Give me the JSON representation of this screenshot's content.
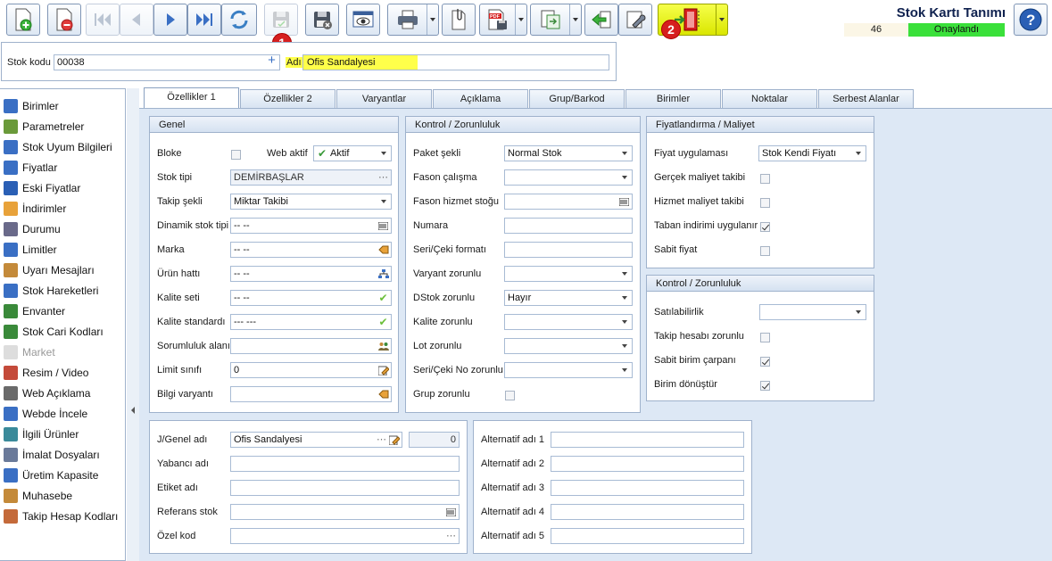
{
  "app": {
    "title": "Stok Kartı Tanımı",
    "status_code": "46",
    "status_label": "Onaylandı"
  },
  "colors": {
    "accent": "#10224f",
    "status": "#3ae03a",
    "highlight": "#ffff4a",
    "badge": "#d61f1f"
  },
  "toolbar": {
    "items": [
      "new-icon",
      "delete-icon",
      "first-icon",
      "prev-icon",
      "next-icon",
      "last-icon",
      "refresh-icon",
      "save-disabled-icon",
      "save-close-icon",
      "preview-icon",
      "print-icon",
      "attach-icon",
      "pdf-icon",
      "export-icon",
      "back-icon",
      "settings-icon",
      "workflow-icon"
    ],
    "badges": [
      "1",
      "2"
    ]
  },
  "header": {
    "stock_code_label": "Stok kodu",
    "stock_code_value": "00038",
    "name_label": "Adı",
    "name_value": "Ofis Sandalyesi"
  },
  "sidebar": {
    "items": [
      {
        "label": "Birimler",
        "icon": "units-icon"
      },
      {
        "label": "Parametreler",
        "icon": "parameters-icon"
      },
      {
        "label": "Stok Uyum Bilgileri",
        "icon": "compliance-icon"
      },
      {
        "label": "Fiyatlar",
        "icon": "price-tag-icon"
      },
      {
        "label": "Eski Fiyatlar",
        "icon": "old-price-icon"
      },
      {
        "label": "İndirimler",
        "icon": "discount-icon"
      },
      {
        "label": "Durumu",
        "icon": "status-icon"
      },
      {
        "label": "Limitler",
        "icon": "limits-icon"
      },
      {
        "label": "Uyarı Mesajları",
        "icon": "warning-icon"
      },
      {
        "label": "Stok Hareketleri",
        "icon": "movements-icon"
      },
      {
        "label": "Envanter",
        "icon": "inventory-icon"
      },
      {
        "label": "Stok Cari Kodları",
        "icon": "account-codes-icon"
      },
      {
        "label": "Market",
        "icon": "market-icon"
      },
      {
        "label": "Resim / Video",
        "icon": "media-icon"
      },
      {
        "label": "Web Açıklama",
        "icon": "web-desc-icon"
      },
      {
        "label": "Webde İncele",
        "icon": "web-view-icon"
      },
      {
        "label": "İlgili Ürünler",
        "icon": "related-icon"
      },
      {
        "label": "İmalat Dosyaları",
        "icon": "manufacturing-icon"
      },
      {
        "label": "Üretim Kapasite",
        "icon": "capacity-icon"
      },
      {
        "label": "Muhasebe",
        "icon": "accounting-icon"
      },
      {
        "label": "Takip Hesap Kodları",
        "icon": "tracking-icon"
      }
    ]
  },
  "tabs": [
    "Özellikler 1",
    "Özellikler 2",
    "Varyantlar",
    "Açıklama",
    "Grup/Barkod",
    "Birimler",
    "Noktalar",
    "Serbest Alanlar"
  ],
  "genel": {
    "title": "Genel",
    "bloke": "Bloke",
    "web_aktif": "Web aktif",
    "web_aktif_value": "Aktif",
    "stok_tipi": "Stok tipi",
    "stok_tipi_value": "DEMİRBAŞLAR",
    "takip_sekli": "Takip şekli",
    "takip_sekli_value": "Miktar Takibi",
    "dinamik_stok_tipi": "Dinamik stok tipi",
    "dinamik_stok_tipi_value": "-- --",
    "marka": "Marka",
    "marka_value": "-- --",
    "urun_hatti": "Ürün hattı",
    "urun_hatti_value": "-- --",
    "kalite_seti": "Kalite seti",
    "kalite_seti_value": "-- --",
    "kalite_standardi": "Kalite standardı",
    "kalite_standardi_value": "--- ---",
    "sorumluluk_alani": "Sorumluluk alanı",
    "sorumluluk_alani_value": "",
    "limit_sinifi": "Limit sınıfı",
    "limit_sinifi_value": "0",
    "bilgi_varyanti": "Bilgi varyantı",
    "bilgi_varyanti_value": ""
  },
  "kontrol": {
    "title": "Kontrol / Zorunluluk",
    "paket_sekli": "Paket şekli",
    "paket_sekli_value": "Normal Stok",
    "fason_calisma": "Fason çalışma",
    "fason_calisma_value": "",
    "fason_hizmet": "Fason hizmet stoğu",
    "fason_hizmet_value": "",
    "numara": "Numara",
    "numara_value": "",
    "seri_ceki_formati": "Seri/Çeki formatı",
    "seri_ceki_formati_value": "",
    "varyant_zorunlu": "Varyant zorunlu",
    "varyant_zorunlu_value": "",
    "dstok_zorunlu": "DStok zorunlu",
    "dstok_zorunlu_value": "Hayır",
    "kalite_zorunlu": "Kalite zorunlu",
    "kalite_zorunlu_value": "",
    "lot_zorunlu": "Lot zorunlu",
    "lot_zorunlu_value": "",
    "seri_ceki_no": "Seri/Çeki No zorunlu",
    "seri_ceki_no_value": "",
    "grup_zorunlu": "Grup zorunlu"
  },
  "fiyat": {
    "title": "Fiyatlandırma / Maliyet",
    "fiyat_uygulamasi": "Fiyat uygulaması",
    "fiyat_uygulamasi_value": "Stok Kendi Fiyatı",
    "gercek_maliyet": "Gerçek maliyet takibi",
    "hizmet_maliyet": "Hizmet maliyet takibi",
    "taban_indirimi": "Taban indirimi uygulanır",
    "sabit_fiyat": "Sabit fiyat"
  },
  "kontrol2": {
    "title": "Kontrol / Zorunluluk",
    "satilabilirlik": "Satılabilirlik",
    "satilabilirlik_value": "",
    "takip_hesabi": "Takip hesabı zorunlu",
    "sabit_birim": "Sabit birim çarpanı",
    "birim_donustur": "Birim dönüştür"
  },
  "names": {
    "genel_adi": "J/Genel adı",
    "genel_adi_value": "Ofis Sandalyesi",
    "genel_adi_count": "0",
    "yabanci_adi": "Yabancı adı",
    "etiket_adi": "Etiket adı",
    "referans_stok": "Referans stok",
    "ozel_kod": "Özel kod"
  },
  "alternatives": {
    "labels": [
      "Alternatif adı 1",
      "Alternatif adı 2",
      "Alternatif adı 3",
      "Alternatif adı 4",
      "Alternatif adı 5"
    ]
  }
}
